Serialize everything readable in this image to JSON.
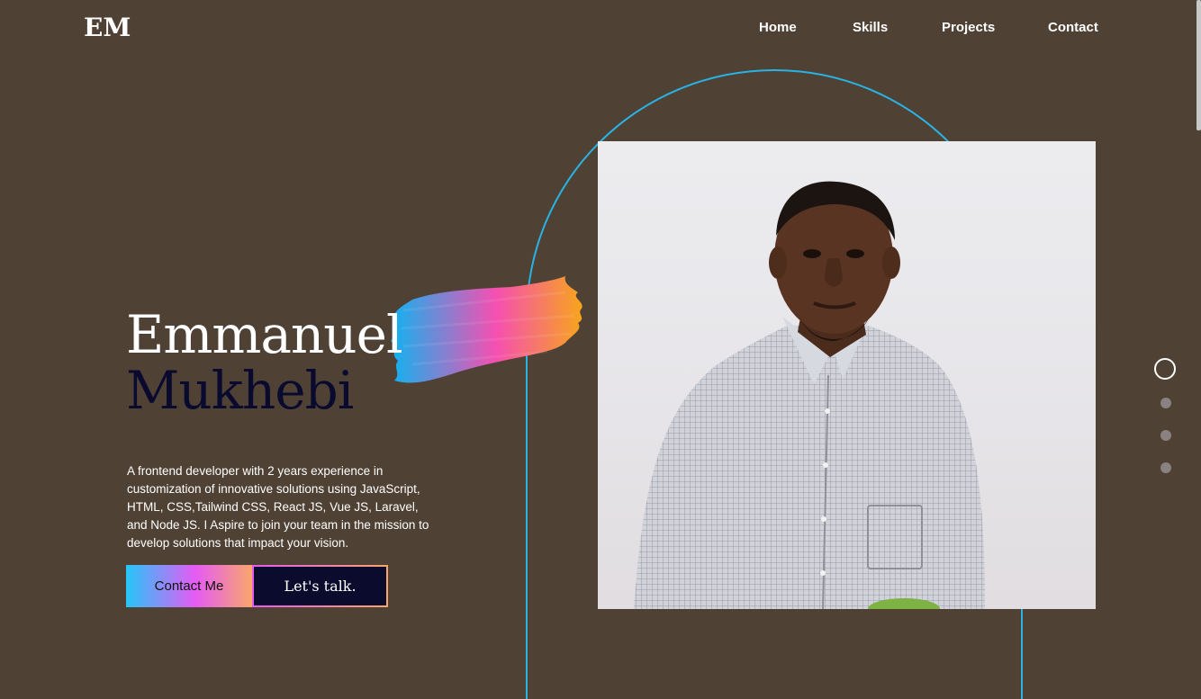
{
  "logo": "EM",
  "nav": {
    "items": [
      {
        "label": "Home"
      },
      {
        "label": "Skills"
      },
      {
        "label": "Projects"
      },
      {
        "label": "Contact"
      }
    ]
  },
  "hero": {
    "first_name": "Emmanuel",
    "last_name": "Mukhebi",
    "bio": "A frontend developer with 2 years experience in customization of innovative solutions using JavaScript, HTML, CSS,Tailwind CSS, React JS, Vue JS, Laravel, and Node JS. I Aspire to join your team in the mission to develop solutions that impact your vision.",
    "contact_button": "Contact Me",
    "talk_button": "Let's talk."
  },
  "pager": {
    "total": 4,
    "active_index": 0
  },
  "colors": {
    "background": "#4f4234",
    "arc": "#29b3e4",
    "last_name": "#0a0a2e",
    "brush_start": "#0fb3f0",
    "brush_mid": "#f64fb1",
    "brush_end": "#f7a51c"
  }
}
